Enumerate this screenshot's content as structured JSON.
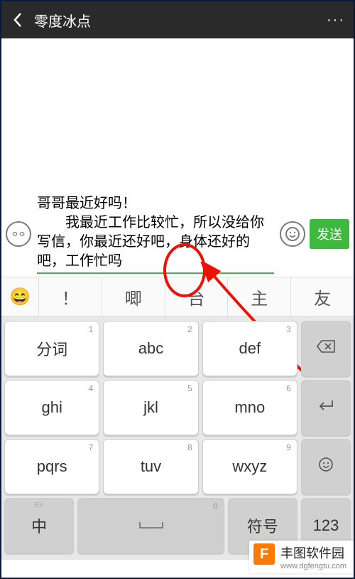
{
  "navbar": {
    "title": "零度冰点",
    "more": "···"
  },
  "input": {
    "line1": "哥哥最近好吗！",
    "rest": "我最近工作比较忙，所以没给你写信，你最近还好吧，身体还好的吧，工作忙吗",
    "send_label": "发送"
  },
  "suggestions": {
    "emoji": "😄",
    "items": [
      "！",
      "唧",
      "台",
      "主",
      "友"
    ]
  },
  "keyboard": {
    "row1": [
      {
        "main": "分词",
        "num": "1"
      },
      {
        "main": "abc",
        "num": "2"
      },
      {
        "main": "def",
        "num": "3"
      }
    ],
    "row2": [
      {
        "main": "ghi",
        "num": "4"
      },
      {
        "main": "jkl",
        "num": "5"
      },
      {
        "main": "mno",
        "num": "6"
      }
    ],
    "row3": [
      {
        "main": "pqrs",
        "num": "7"
      },
      {
        "main": "tuv",
        "num": "8"
      },
      {
        "main": "wxyz",
        "num": "9"
      }
    ],
    "row4": {
      "lang": "中",
      "lang_sub": "En",
      "zero": "0",
      "symbol": "符号",
      "num_mode": "123"
    },
    "side": {
      "backspace": "⌫",
      "enter": "↵",
      "tool": "☺"
    }
  },
  "watermark": {
    "logo": "F",
    "name": "丰图软件园",
    "url": "www.dgfengtu.com"
  }
}
